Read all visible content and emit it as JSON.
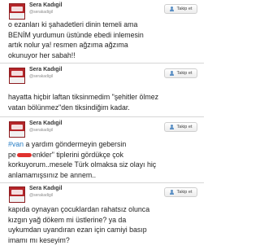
{
  "follow_label": "Takip et",
  "tweets": [
    {
      "name": "Sera Kadıgil",
      "handle": "@serakadigil",
      "lines": [
        "o ezanları ki şahadetleri dinin temeli ama",
        "BENİM yurdumun üstünde ebedi inlemesin",
        "artık nolur ya! resmen ağzıma ağzıma",
        "okunuyor her sabah!!"
      ]
    },
    {
      "name": "Sera Kadıgil",
      "handle": "@serakadigil",
      "lines": [
        "hayatta hiçbir laftan tiksinmedim \"şehitler ölmez",
        "vatan bölünmez\"den tiksindiğim kadar."
      ]
    },
    {
      "name": "Sera Kadıgil",
      "handle": "@serakadigil",
      "hashtag": "#van",
      "line1_rest": " a yardım göndermeyin gebersin",
      "line2_prefix": "pe",
      "line2_suffix": "enkler\" tiplerini gördükçe çok",
      "lines_rest": [
        "korkuyorum..mesele Türk olmaksa siz olayı hiç",
        "anlamamışsınız be annem.."
      ]
    },
    {
      "name": "Sera Kadıgil",
      "handle": "@serakadigil",
      "lines": [
        "kapıda oynayan çocuklardan rahatsız olunca",
        "kızgın yağ dökem mi üstlerine? ya da",
        "uykumdan uyandıran ezan için camiyi basıp",
        "imamı mı keseyim?"
      ]
    }
  ]
}
